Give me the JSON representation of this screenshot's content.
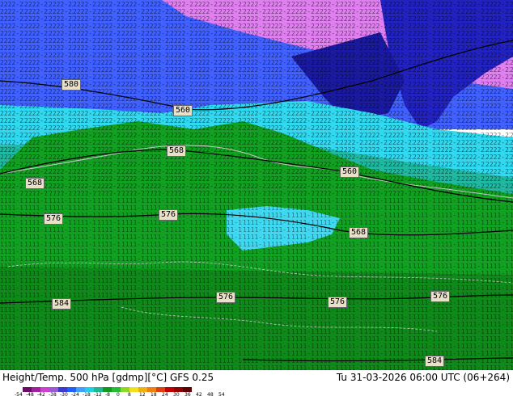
{
  "map": {
    "contour_labels": [
      "580",
      "560",
      "568",
      "560",
      "568",
      "576",
      "576",
      "568",
      "584",
      "576",
      "576",
      "576",
      "584"
    ]
  },
  "footer": {
    "title_left": "Height/Temp. 500 hPa [gdmp][°C] GFS 0.25",
    "title_right": "Tu 31-03-2026 06:00 UTC (06+264)"
  },
  "legend": {
    "ticks": [
      "-54",
      "-48",
      "-42",
      "-38",
      "-30",
      "-24",
      "-18",
      "-12",
      "-8",
      "0",
      "8",
      "12",
      "18",
      "24",
      "30",
      "36",
      "42",
      "48",
      "54"
    ],
    "colors": [
      "#6a0a6a",
      "#a020a0",
      "#d040d0",
      "#9b59d6",
      "#3a3ad0",
      "#2060ff",
      "#40a0ff",
      "#20d0e8",
      "#20b890",
      "#0f9a20",
      "#22c030",
      "#8fd81e",
      "#f0e020",
      "#f0b010",
      "#f08010",
      "#e04010",
      "#c00000",
      "#900000",
      "#600000"
    ]
  }
}
